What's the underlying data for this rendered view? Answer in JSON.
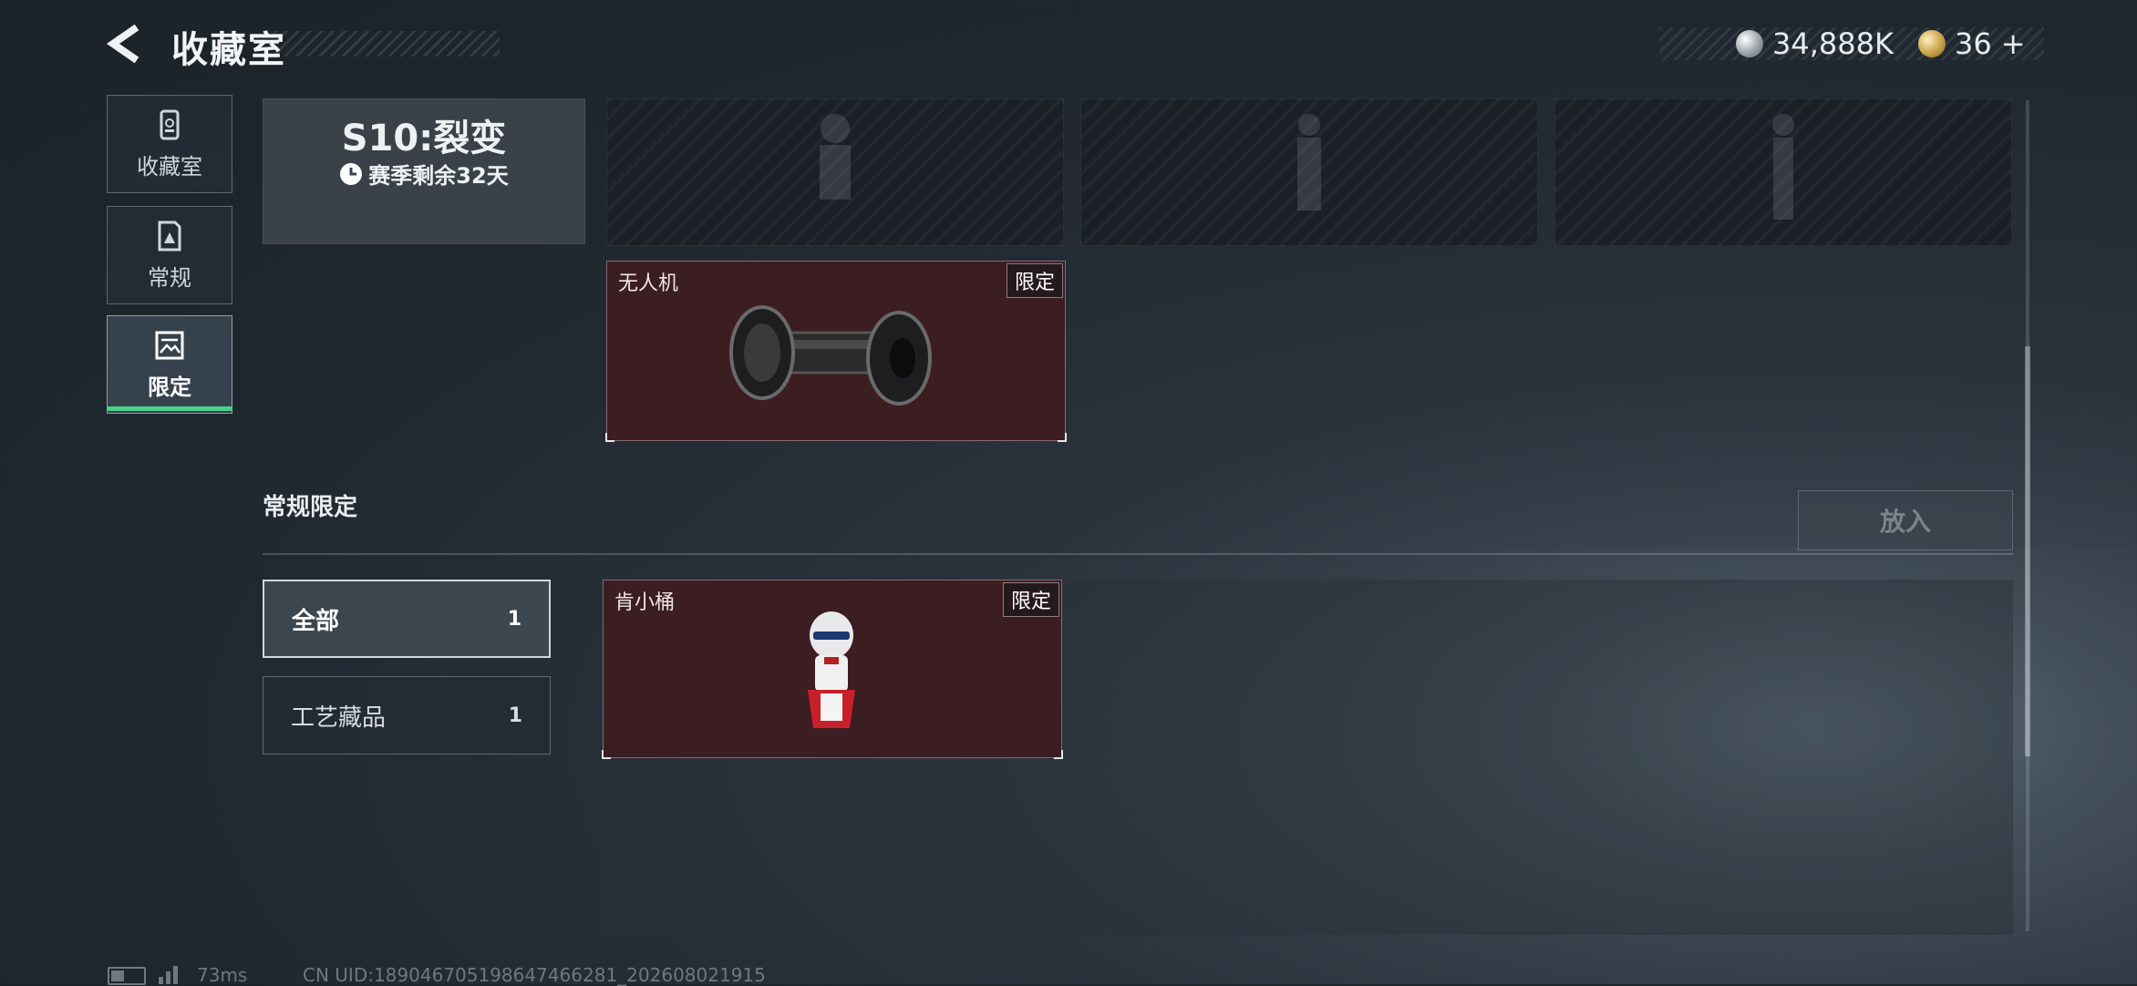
{
  "header": {
    "title": "收藏室",
    "currency": [
      {
        "icon": "silver-coin-icon",
        "value": "34,888K"
      },
      {
        "icon": "gold-badge-icon",
        "value": "36"
      }
    ],
    "add_symbol": "+"
  },
  "sidebar": {
    "items": [
      {
        "label": "收藏室",
        "icon": "collection-icon",
        "active": false
      },
      {
        "label": "常规",
        "icon": "regular-card-icon",
        "active": false
      },
      {
        "label": "限定",
        "icon": "limited-image-icon",
        "active": true
      }
    ],
    "active_color": "#4bd08a"
  },
  "season": {
    "name": "S10:裂变",
    "remaining": "赛季剩余32天"
  },
  "season_items": [
    {
      "name": "无人机",
      "tag": "限定",
      "icon": "drone-roller-icon"
    }
  ],
  "section": {
    "title": "常规限定",
    "put_button": "放入"
  },
  "filters": [
    {
      "label": "全部",
      "count": "1",
      "active": true
    },
    {
      "label": "工艺藏品",
      "count": "1",
      "active": false
    }
  ],
  "section_items": [
    {
      "name": "肯小桶",
      "tag": "限定",
      "icon": "colonel-figurine-icon"
    }
  ],
  "status_bar": {
    "ping": "73ms",
    "uid": "CN UID:18904670519864746628​1_202608021915"
  },
  "colors": {
    "card_red": "#3c1d22",
    "locked_bg": "#1a2026",
    "season_card": "#3a4149"
  }
}
